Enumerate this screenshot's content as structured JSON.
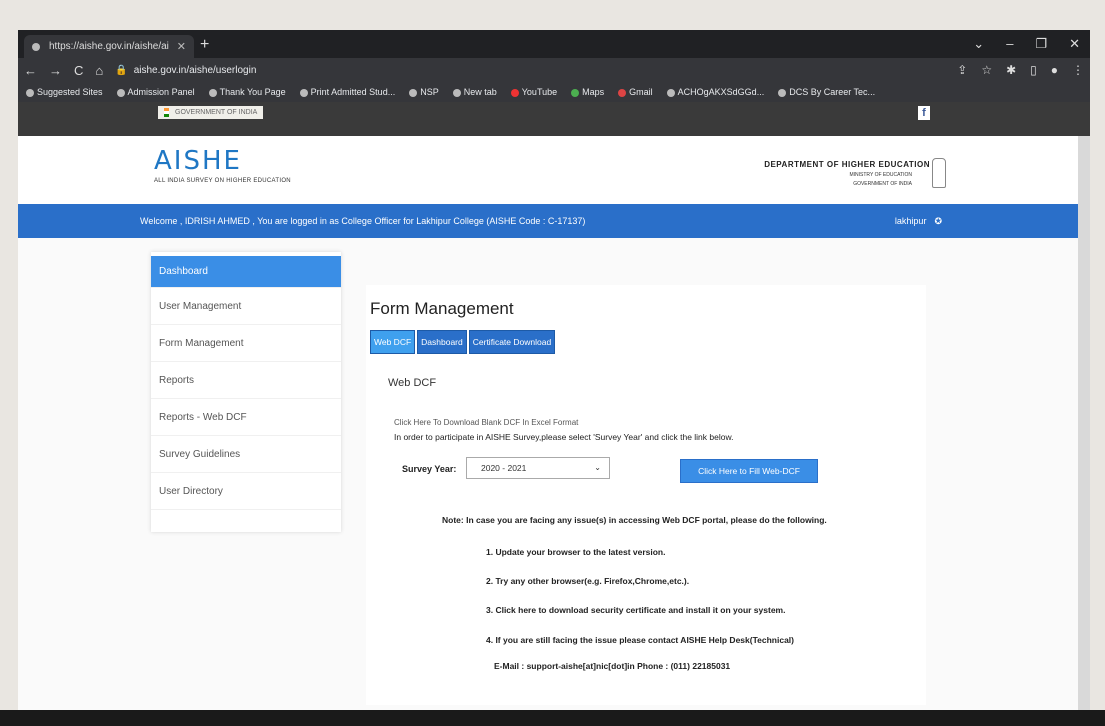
{
  "browser": {
    "tab_title": "https://aishe.gov.in/aishe/aishe/login",
    "url": "aishe.gov.in/aishe/userlogin",
    "bookmarks": [
      "Suggested Sites",
      "Admission Panel",
      "Thank You Page",
      "Print Admitted Stud...",
      "NSP",
      "New tab",
      "YouTube",
      "Maps",
      "Gmail",
      "ACHOgAKXSdGGd...",
      "DCS By Career Tec..."
    ]
  },
  "gov_strip": {
    "label": "GOVERNMENT OF INDIA"
  },
  "header": {
    "logo": "AISHE",
    "logo_sub": "ALL INDIA SURVEY ON HIGHER EDUCATION",
    "dept": "DEPARTMENT OF HIGHER EDUCATION",
    "ministry": "MINISTRY OF EDUCATION",
    "gov": "GOVERNMENT OF INDIA"
  },
  "welcome": {
    "text": "Welcome , IDRISH AHMED , You are logged in as College Officer for Lakhipur College (AISHE Code : C-17137)",
    "location": "lakhipur"
  },
  "sidebar": {
    "items": [
      {
        "label": "Dashboard",
        "active": true
      },
      {
        "label": "User Management"
      },
      {
        "label": "Form Management"
      },
      {
        "label": "Reports"
      },
      {
        "label": "Reports - Web DCF"
      },
      {
        "label": "Survey Guidelines"
      },
      {
        "label": "User Directory"
      }
    ]
  },
  "main": {
    "title": "Form Management",
    "tabs": [
      "Web DCF",
      "Dashboard",
      "Certificate Download"
    ],
    "section": "Web DCF",
    "download_link": "Click Here To Download Blank DCF In Excel Format",
    "instruction": "In order to participate in AISHE Survey,please select 'Survey Year' and click the link below.",
    "survey_label": "Survey Year:",
    "survey_value": "2020 - 2021",
    "fill_button": "Click Here to Fill Web-DCF",
    "note": "Note: In case you are facing any issue(s) in accessing Web DCF portal, please do the following.",
    "steps": [
      "1. Update your browser to the latest version.",
      "2. Try any other browser(e.g. Firefox,Chrome,etc.).",
      "3. Click here to download security certificate and install it on your system.",
      "4. If you are still facing the issue please contact AISHE Help Desk(Technical)"
    ],
    "contact": "E-Mail : support-aishe[at]nic[dot]in Phone : (011) 22185031"
  }
}
